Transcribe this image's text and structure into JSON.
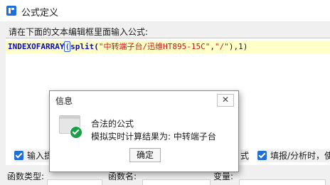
{
  "window": {
    "title": "公式定义"
  },
  "editor": {
    "prompt": "请在下面的文本编辑框里面输入公式:",
    "formula": {
      "func_name": "INDEXOFARRAY",
      "open_paren": "(",
      "inner_func": "split(",
      "arg1": "\"中转端子台/迅维HT895-15C\"",
      "comma1": ",",
      "arg2": "\"/\"",
      "tail": "),1)"
    }
  },
  "options": {
    "left_checkbox_label": "输入提",
    "middle_fragment": "式",
    "right_checkbox_label": "填报/分析时，使"
  },
  "columns": {
    "function_type": "函数类型:",
    "function_name": "函数名:",
    "variable": "变量:"
  },
  "dialog": {
    "title": "信息",
    "close_glyph": "✕",
    "line1": "合法的公式",
    "line2": "模拟实时计算结果为: 中转端子台",
    "ok_label": "确定"
  }
}
